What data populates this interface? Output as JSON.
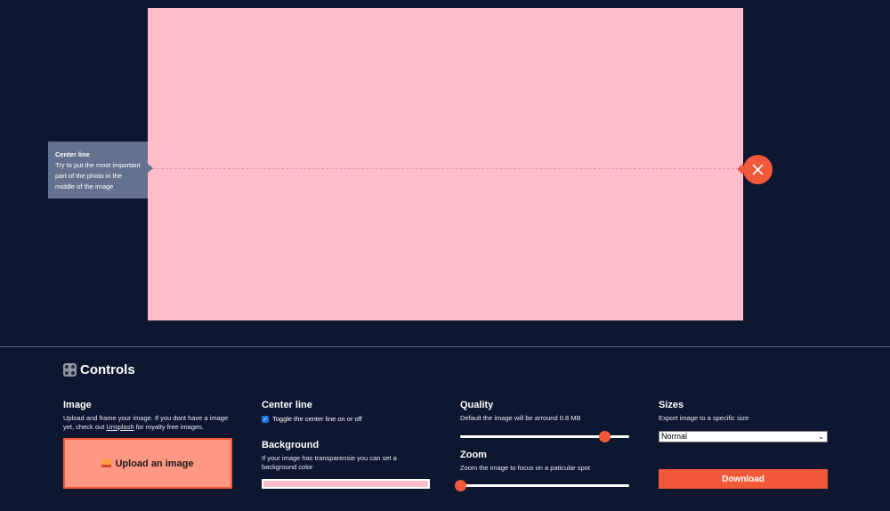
{
  "canvas": {
    "background_color": "#ffbdca",
    "center_line_visible": true
  },
  "tooltip": {
    "title": "Center line",
    "body": "Try to put the most important part of the photo in the middle of the image"
  },
  "close_button": {
    "icon": "close-icon",
    "color": "#f2593a"
  },
  "controls": {
    "title": "Controls",
    "title_icon": "control-knobs-icon",
    "image": {
      "heading": "Image",
      "desc_before": "Upload and frame your image. If you dont have a image yet, check out ",
      "link": "Unsplash",
      "desc_after": " for royalty free images.",
      "upload_label": "Upload an image",
      "upload_icon": "picture-icon"
    },
    "center_line": {
      "heading": "Center line",
      "toggle_label": "Toggle the center line on or off",
      "checked": true
    },
    "background": {
      "heading": "Background",
      "desc": "If your image has transparensie you can set a background color",
      "color": "#ffbdca"
    },
    "quality": {
      "heading": "Quality",
      "desc": "Default the image will be arround 0.8 MB",
      "value_fraction": 0.85
    },
    "zoom": {
      "heading": "Zoom",
      "desc": "Zoom the image to focus on a paticular spot",
      "value_fraction": 0.0
    },
    "sizes": {
      "heading": "Sizes",
      "desc": "Export image to a specific size",
      "selected": "Normal",
      "download_label": "Download"
    }
  },
  "colors": {
    "accent": "#f2593a",
    "background": "#0e1730",
    "tooltip": "#64728f"
  }
}
